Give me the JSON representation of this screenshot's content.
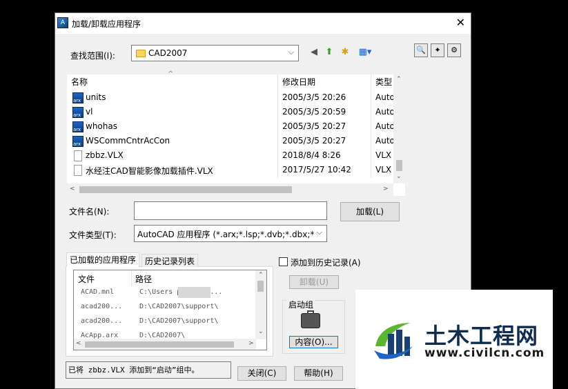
{
  "window": {
    "title": "加载/卸载应用程序",
    "close": "✕"
  },
  "lookin": {
    "label": "查找范围(I):",
    "value": "CAD2007"
  },
  "filelist": {
    "columns": [
      "名称",
      "修改日期",
      "类型"
    ],
    "rows": [
      {
        "name": "units",
        "date": "2005/3/5 20:26",
        "type": "Auto",
        "icon": "arx-icon"
      },
      {
        "name": "vl",
        "date": "2005/3/5 20:59",
        "type": "Auto",
        "icon": "arx-icon"
      },
      {
        "name": "whohas",
        "date": "2005/3/5 20:27",
        "type": "Auto",
        "icon": "arx-icon"
      },
      {
        "name": "WSCommCntrAcCon",
        "date": "2005/3/5 20:27",
        "type": "Auto",
        "icon": "arx-icon"
      },
      {
        "name": "zbbz.VLX",
        "date": "2018/8/4 8:26",
        "type": "VLX",
        "icon": "file-icon"
      },
      {
        "name": "水经注CAD智能影像加载插件.VLX",
        "date": "2017/5/27 10:42",
        "type": "VLX",
        "icon": "file-icon"
      }
    ]
  },
  "filename": {
    "label": "文件名(N):",
    "value": ""
  },
  "filetype": {
    "label": "文件类型(T):",
    "value": "AutoCAD 应用程序 (*.arx;*.lsp;*.dvb;*.dbx;*.vlx"
  },
  "load_button": "加载(L)",
  "tabs": [
    "已加载的应用程序",
    "历史记录列表"
  ],
  "add_history": "添加到历史记录(A)",
  "unload_button": "卸载(U)",
  "loaded": {
    "columns": [
      "文件",
      "路径"
    ],
    "rows": [
      {
        "file": "ACAD.mnl",
        "path": "C:\\Users      ppData\\R..."
      },
      {
        "file": "acad200...",
        "path": "D:\\CAD2007\\support\\"
      },
      {
        "file": "acad200...",
        "path": "D:\\CAD2007\\support\\"
      },
      {
        "file": "AcApp.arx",
        "path": "D:\\CAD2007\\"
      }
    ]
  },
  "startup": {
    "label": "启动组",
    "contents_button": "内容(O)..."
  },
  "status_text": "已将 zbbz.VLX 添加到“启动”组中。",
  "close_button": "关闭(C)",
  "help_button": "帮助(H)",
  "watermark": {
    "title": "土木工程网",
    "url": "www.civilcn.com"
  },
  "colors": {
    "accent_blue": "#1e63c8",
    "logo_green": "#5cb531",
    "logo_navy": "#0e2c4f"
  }
}
